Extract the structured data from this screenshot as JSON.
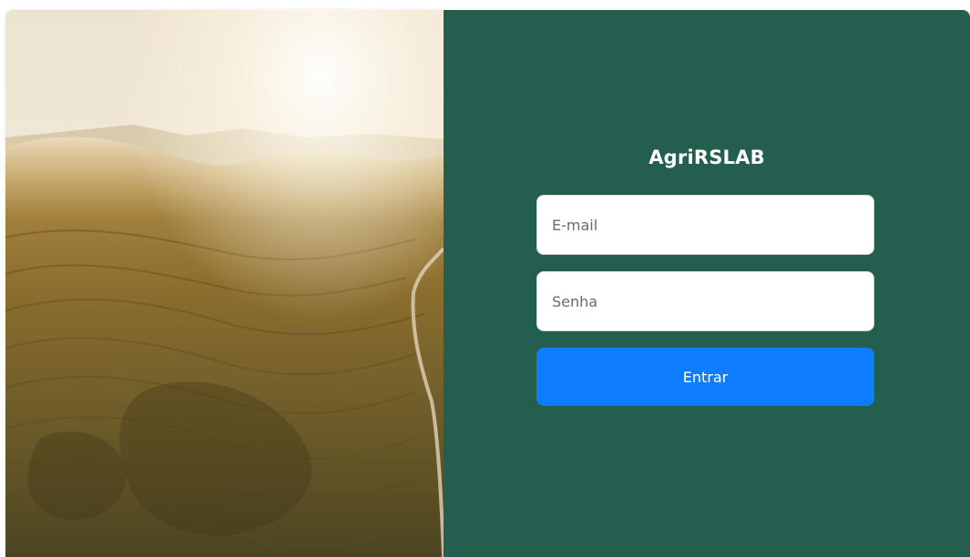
{
  "app": {
    "title": "AgriRSLAB"
  },
  "login": {
    "email_placeholder": "E-mail",
    "password_placeholder": "Senha",
    "submit_label": "Entrar"
  },
  "colors": {
    "form_panel_bg": "#235e4f",
    "button_bg": "#0d7dfd",
    "button_text": "#ffffff",
    "title_text": "#ffffff"
  }
}
